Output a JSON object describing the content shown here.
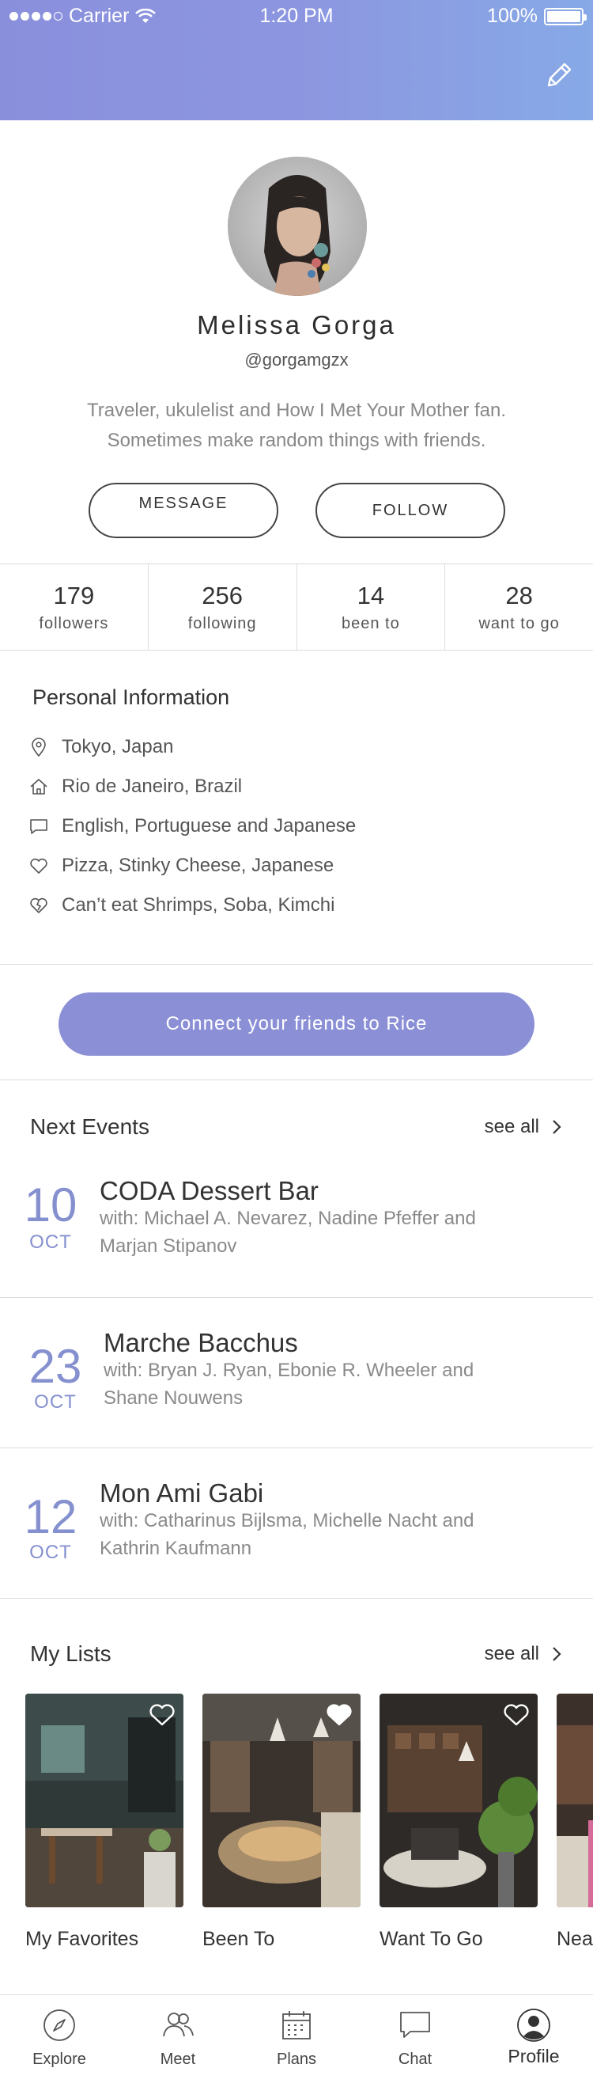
{
  "status_bar": {
    "carrier": "Carrier",
    "time": "1:20 PM",
    "battery": "100%"
  },
  "profile": {
    "name": "Melissa Gorga",
    "handle": "@gorgamgzx",
    "bio": "Traveler, ukulelist and How I Met Your Mother fan. Sometimes make random things with friends.",
    "message_label": "MESSAGE",
    "follow_label": "FOLLOW"
  },
  "stats": [
    {
      "value": "179",
      "label": "followers"
    },
    {
      "value": "256",
      "label": "following"
    },
    {
      "value": "14",
      "label": "been to"
    },
    {
      "value": "28",
      "label": "want to go"
    }
  ],
  "personal_info": {
    "title": "Personal Information",
    "items": [
      {
        "icon": "location-pin-icon",
        "text": "Tokyo, Japan"
      },
      {
        "icon": "home-icon",
        "text": "Rio de Janeiro, Brazil"
      },
      {
        "icon": "chat-bubble-icon",
        "text": "English, Portuguese and Japanese"
      },
      {
        "icon": "heart-outline-icon",
        "text": "Pizza, Stinky Cheese, Japanese"
      },
      {
        "icon": "broken-heart-icon",
        "text": "Can’t eat Shrimps, Soba, Kimchi"
      }
    ]
  },
  "connect_label": "Connect your friends to Rice",
  "next_events": {
    "title": "Next Events",
    "see_all": "see all",
    "items": [
      {
        "day": "10",
        "month": "OCT",
        "title": "CODA Dessert Bar",
        "with": "with: Michael A. Nevarez, Nadine Pfeffer and Marjan Stipanov"
      },
      {
        "day": "23",
        "month": "OCT",
        "title": "Marche Bacchus",
        "with": "with: Bryan J. Ryan, Ebonie R. Wheeler and Shane Nouwens"
      },
      {
        "day": "12",
        "month": "OCT",
        "title": "Mon Ami Gabi",
        "with": "with: Catharinus Bijlsma, Michelle Nacht and Kathrin Kaufmann"
      }
    ]
  },
  "my_lists": {
    "title": "My Lists",
    "see_all": "see all",
    "items": [
      {
        "name": "My Favorites"
      },
      {
        "name": "Been To"
      },
      {
        "name": "Want To Go"
      },
      {
        "name": "Near"
      }
    ]
  },
  "tabs": [
    {
      "label": "Explore",
      "icon": "compass-icon"
    },
    {
      "label": "Meet",
      "icon": "people-icon"
    },
    {
      "label": "Plans",
      "icon": "calendar-icon"
    },
    {
      "label": "Chat",
      "icon": "chat-icon"
    },
    {
      "label": "Profile",
      "icon": "profile-icon"
    }
  ],
  "colors": {
    "accent": "#8a8fd6",
    "header_start": "#8a8fdc",
    "header_end": "#87a9e6"
  }
}
